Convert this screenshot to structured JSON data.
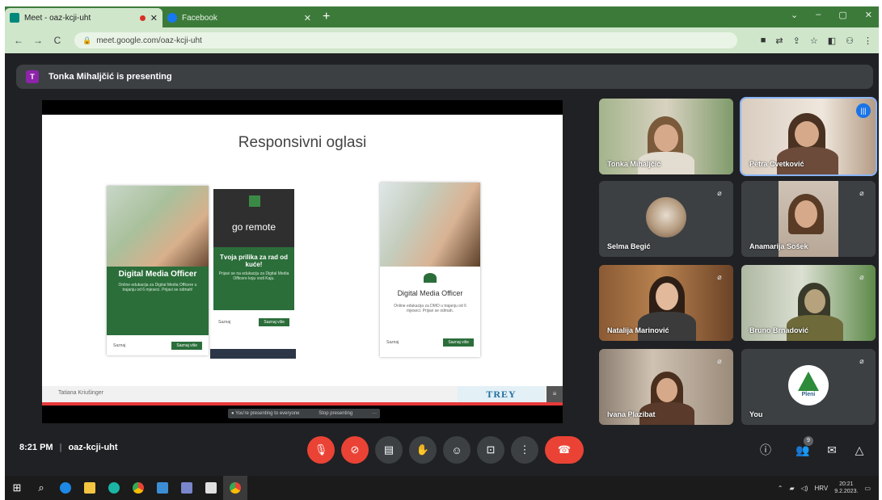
{
  "browser": {
    "tabs": [
      {
        "title": "Meet - oaz-kcji-uht",
        "active": true
      },
      {
        "title": "Facebook",
        "active": false
      }
    ],
    "new_tab": "+",
    "window_controls": [
      "⌄",
      "–",
      "▢",
      "✕"
    ],
    "url": "meet.google.com/oaz-kcji-uht",
    "nav": {
      "back": "←",
      "forward": "→",
      "reload": "C"
    }
  },
  "meet": {
    "presenting_initial": "T",
    "presenting_text": "Tonka Mihaljčić is presenting",
    "slide": {
      "title": "Responsivni oglasi",
      "ad1": {
        "title": "Digital Media Officer",
        "desc": "Online edukacija za Digital Media Officere u trajanju od 6 mjeseci. Prijavi se odmah!",
        "left": "Saznaj",
        "button": "Saznaj više"
      },
      "ad2": {
        "brand": "go remote",
        "title": "Tvoja prilika za rad od kuće!",
        "desc": "Prijavi se na edukaciju za Digital Media Officere koju vodi Kaju.",
        "left": "Saznaj",
        "button": "Saznaj više"
      },
      "ad3": {
        "title": "Digital Media Officer",
        "desc": "Online edukacija za DMO u trajanju od 6 mjeseci. Prijavi se odmah.",
        "left": "Saznaj",
        "button": "Saznaj više"
      },
      "presenter_name": "Tatiana Kriušinger",
      "logo_text": "TREY"
    },
    "presenting_bar": {
      "text": "● You're presenting to everyone",
      "stop": "Stop presenting",
      "more": "···"
    },
    "participants": [
      {
        "name": "Tonka Mihaljčić",
        "mic": "muted"
      },
      {
        "name": "Petra Cvetković",
        "mic": "speaking"
      },
      {
        "name": "Selma Begić",
        "mic": "muted"
      },
      {
        "name": "Anamarija Sošek",
        "mic": "muted"
      },
      {
        "name": "Natalija Marinović",
        "mic": "muted"
      },
      {
        "name": "Bruno Brnadović",
        "mic": "muted"
      },
      {
        "name": "Ivana Plazibat",
        "mic": "muted"
      },
      {
        "name": "You",
        "mic": "muted",
        "avatar_text": "Pleni"
      }
    ],
    "meeting_time": "8:21 PM",
    "meeting_code": "oaz-kcji-uht",
    "participant_count": "9",
    "colors": {
      "end_call": "#ea4335",
      "active_border": "#8ab4f8",
      "tab_bar": "#3c7a3a"
    }
  },
  "taskbar": {
    "lang": "HRV",
    "time": "20:21",
    "date": "9.2.2023."
  }
}
